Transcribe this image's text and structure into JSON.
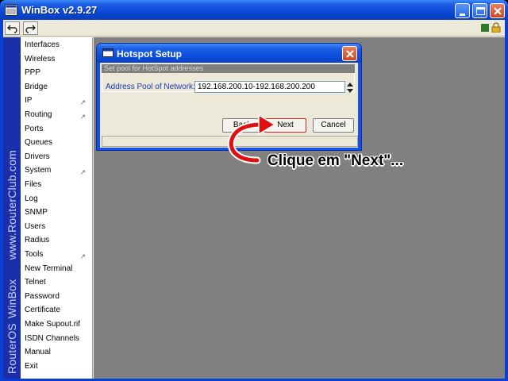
{
  "window": {
    "title": "WinBox v2.9.27",
    "controls": [
      "minimize-icon",
      "maximize-icon",
      "close-icon"
    ],
    "accent": "#0a4bd8"
  },
  "toolbar": {
    "undo_icon": "undo-icon",
    "redo_icon": "redo-icon",
    "status_colors": [
      "#2a7a2a",
      "#e0b020"
    ]
  },
  "sidebar": {
    "vertical_text": "RouterOS WinBox    www.RouterClub.com",
    "items": [
      {
        "label": "Interfaces",
        "submenu": false
      },
      {
        "label": "Wireless",
        "submenu": false
      },
      {
        "label": "PPP",
        "submenu": false
      },
      {
        "label": "Bridge",
        "submenu": false
      },
      {
        "label": "IP",
        "submenu": true
      },
      {
        "label": "Routing",
        "submenu": true
      },
      {
        "label": "Ports",
        "submenu": false
      },
      {
        "label": "Queues",
        "submenu": false
      },
      {
        "label": "Drivers",
        "submenu": false
      },
      {
        "label": "System",
        "submenu": true
      },
      {
        "label": "Files",
        "submenu": false
      },
      {
        "label": "Log",
        "submenu": false
      },
      {
        "label": "SNMP",
        "submenu": false
      },
      {
        "label": "Users",
        "submenu": false
      },
      {
        "label": "Radius",
        "submenu": false
      },
      {
        "label": "Tools",
        "submenu": true
      },
      {
        "label": "New Terminal",
        "submenu": false
      },
      {
        "label": "Telnet",
        "submenu": false
      },
      {
        "label": "Password",
        "submenu": false
      },
      {
        "label": "Certificate",
        "submenu": false
      },
      {
        "label": "Make Supout.rif",
        "submenu": false
      },
      {
        "label": "ISDN Channels",
        "submenu": false
      },
      {
        "label": "Manual",
        "submenu": false
      },
      {
        "label": "Exit",
        "submenu": false
      }
    ]
  },
  "dialog": {
    "title": "Hotspot Setup",
    "caption": "Set pool for HotSpot addresses",
    "field_label": "Address Pool of Network:",
    "field_value": "192.168.200.10-192.168.200.200",
    "back_label": "Back",
    "next_label": "Next",
    "cancel_label": "Cancel"
  },
  "annotation": {
    "text": "Clique em \"Next\"...",
    "arrow_color": "#e01010"
  }
}
